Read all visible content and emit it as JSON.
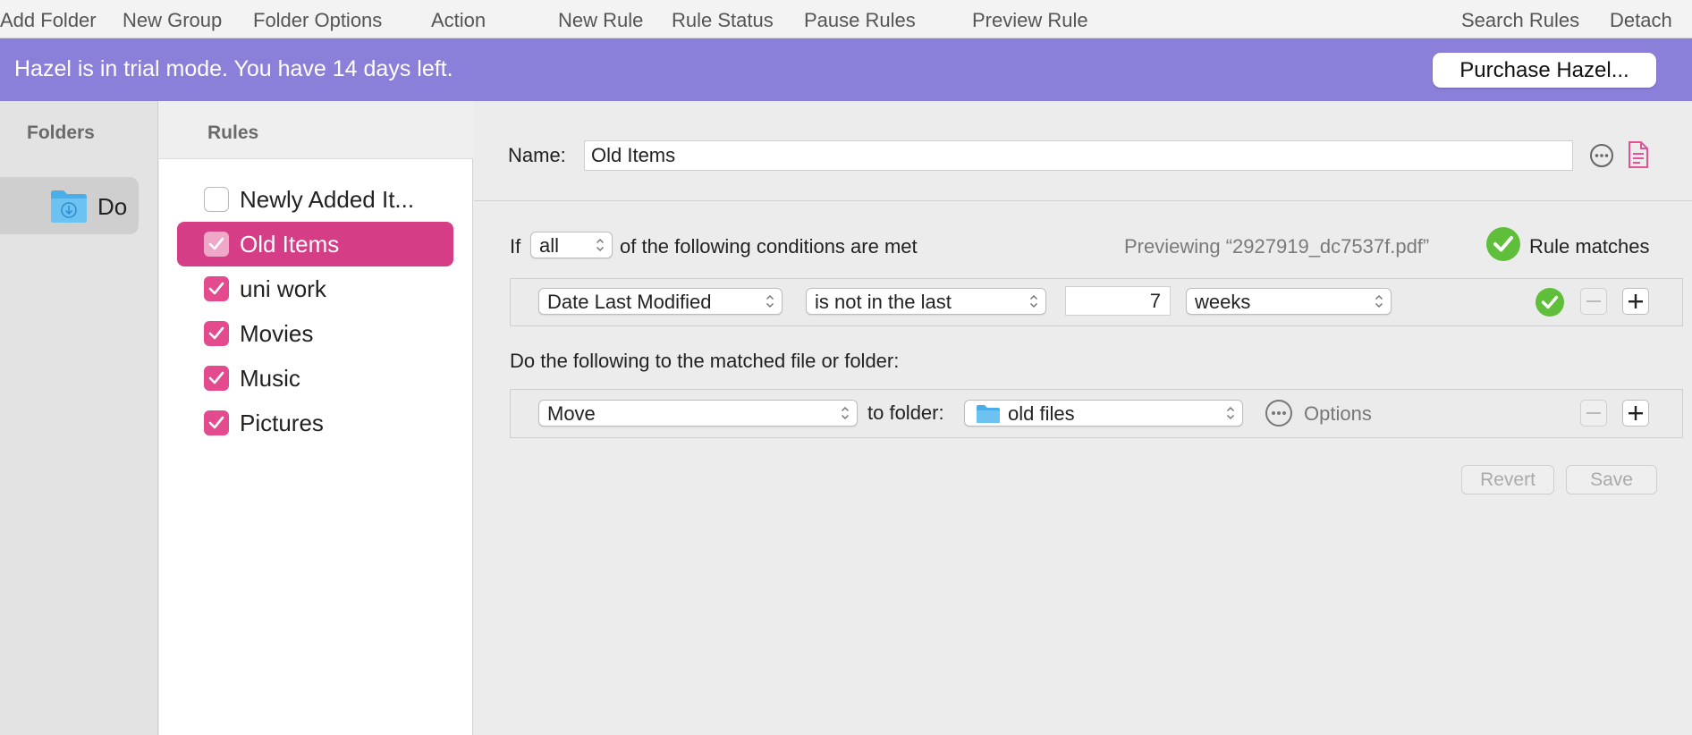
{
  "toolbar": {
    "items": [
      "Add Folder",
      "New Group",
      "Folder Options",
      "Action",
      "New Rule",
      "Rule Status",
      "Pause Rules",
      "Preview Rule",
      "Search Rules",
      "Detach"
    ]
  },
  "banner": {
    "text": "Hazel is in trial mode. You have 14 days left.",
    "button": "Purchase Hazel..."
  },
  "folders": {
    "header": "Folders",
    "items": [
      {
        "label": "Do",
        "icon": "downloads-folder-icon"
      }
    ]
  },
  "rules": {
    "header": "Rules",
    "items": [
      {
        "label": "Newly Added It...",
        "checked": false,
        "selected": false
      },
      {
        "label": "Old Items",
        "checked": true,
        "selected": true
      },
      {
        "label": "uni work",
        "checked": true,
        "selected": false
      },
      {
        "label": "Movies",
        "checked": true,
        "selected": false
      },
      {
        "label": "Music",
        "checked": true,
        "selected": false
      },
      {
        "label": "Pictures",
        "checked": true,
        "selected": false
      }
    ]
  },
  "editor": {
    "name_label": "Name:",
    "name_value": "Old Items",
    "if_label": "If",
    "match_mode": "all",
    "conditions_suffix": "of the following conditions are met",
    "preview_text": "Previewing “2927919_dc7537f.pdf”",
    "match_status": "Rule matches",
    "condition": {
      "attribute": "Date Last Modified",
      "operator": "is not in the last",
      "amount": "7",
      "unit": "weeks"
    },
    "actions_label": "Do the following to the matched file or folder:",
    "action": {
      "verb": "Move",
      "to_label": "to folder:",
      "target": "old files",
      "options_label": "Options"
    },
    "revert_label": "Revert",
    "save_label": "Save"
  },
  "colors": {
    "accent": "#d63d87",
    "banner": "#8a7fd9",
    "check": "#5fbf3a"
  }
}
